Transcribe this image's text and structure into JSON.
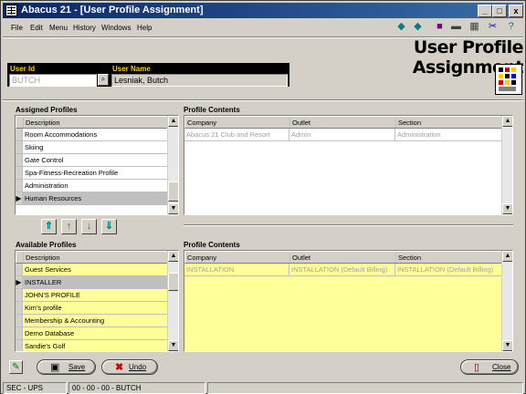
{
  "window": {
    "title": "Abacus 21 - [User Profile Assignment]",
    "controls": [
      "_",
      "□",
      "x"
    ]
  },
  "menu": [
    "File",
    "Edit",
    "Menu",
    "History",
    "Windows",
    "Help"
  ],
  "toolbar": {
    "icons": [
      "nav-back-icon",
      "nav-forward-icon",
      "book-icon",
      "print-icon",
      "calculator-icon",
      "tools-icon",
      "help-icon"
    ]
  },
  "page_title": "User Profile Assignment",
  "user": {
    "id_label": "User Id",
    "id_value": "BUTCH",
    "name_label": "User Name",
    "name_value": "Lesniak, Butch"
  },
  "assigned": {
    "label": "Assigned Profiles",
    "header": "Description",
    "rows": [
      "Room Accommodations",
      "Skiing",
      "Gate Control",
      "Spa-Fitness-Recreation Profile",
      "Administration",
      "Human Resources"
    ],
    "selected_index": 5
  },
  "assigned_contents": {
    "label": "Profile Contents",
    "headers": [
      "Company",
      "Outlet",
      "Section"
    ],
    "rows": [
      [
        "Abacus 21 Club and Resort",
        "Admin",
        "Administration"
      ]
    ]
  },
  "move_buttons": [
    "move-first-icon",
    "move-up-icon",
    "move-down-icon",
    "move-last-icon"
  ],
  "available": {
    "label": "Available Profiles",
    "header": "Description",
    "rows": [
      "Guest Services",
      "INSTALLER",
      "JOHN'S PROFILE",
      "Kim's profile",
      "Membership & Accounting",
      "Demo Database",
      "Sandie's Golf"
    ],
    "selected_index": 1
  },
  "available_contents": {
    "label": "Profile Contents",
    "headers": [
      "Company",
      "Outlet",
      "Section"
    ],
    "rows": [
      [
        "INSTALLATION",
        "INSTALLATION (Default Billing)",
        "INSTALLATION (Default Billing)"
      ]
    ]
  },
  "buttons": {
    "save": "Save",
    "undo": "Undo",
    "close": "Close"
  },
  "status": {
    "left": "SEC - UPS",
    "middle": "00 - 00 - 00 - BUTCH"
  }
}
